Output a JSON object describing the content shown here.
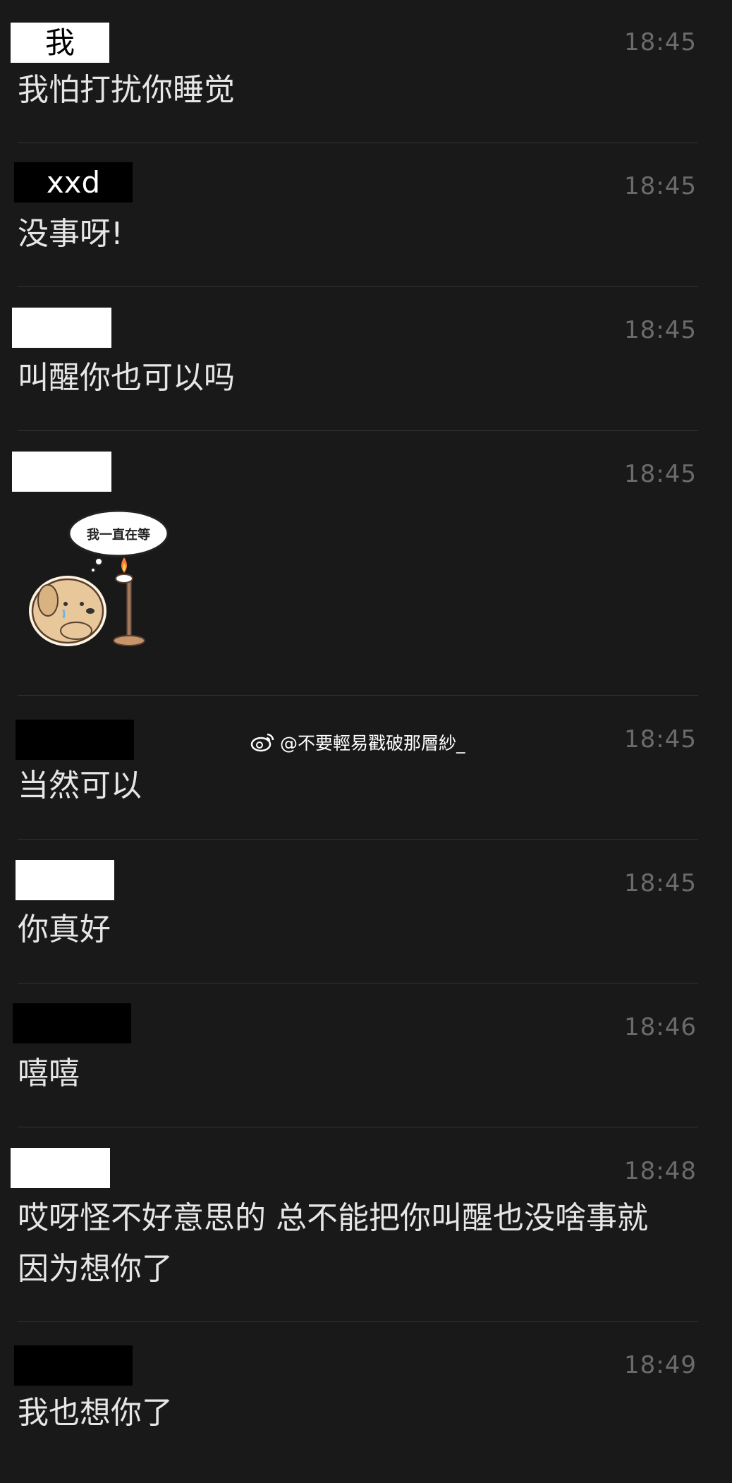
{
  "chat": {
    "messages": [
      {
        "sender": "我",
        "sender_style": "white",
        "time": "18:45",
        "text": "我怕打扰你睡觉"
      },
      {
        "sender": "xxd",
        "sender_style": "black",
        "time": "18:45",
        "text": "没事呀!"
      },
      {
        "sender": "",
        "sender_style": "white",
        "time": "18:45",
        "text": "叫醒你也可以吗"
      },
      {
        "sender": "",
        "sender_style": "white",
        "time": "18:45",
        "sticker_text": "我一直在等"
      },
      {
        "sender": "",
        "sender_style": "black",
        "time": "18:45",
        "text": "当然可以"
      },
      {
        "sender": "",
        "sender_style": "white",
        "time": "18:45",
        "text": "你真好"
      },
      {
        "sender": "",
        "sender_style": "black",
        "time": "18:46",
        "text": "嘻嘻"
      },
      {
        "sender": "",
        "sender_style": "white",
        "time": "18:48",
        "text": "哎呀怪不好意思的 总不能把你叫醒也没啥事就\n因为想你了"
      },
      {
        "sender": "",
        "sender_style": "black",
        "time": "18:49",
        "text": "我也想你了"
      }
    ]
  },
  "watermark": {
    "text": "@不要輕易戳破那層紗_",
    "icon": "weibo-icon"
  },
  "colors": {
    "background": "#191919",
    "divider": "#333333",
    "time": "#6b6b6b",
    "text": "#e6e6e6"
  }
}
